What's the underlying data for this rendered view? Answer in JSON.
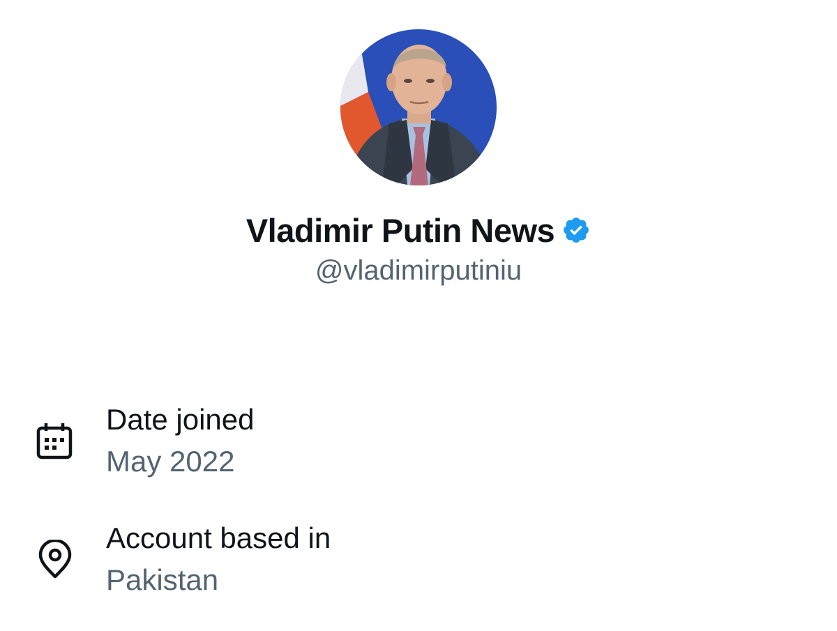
{
  "profile": {
    "display_name": "Vladimir Putin News",
    "handle": "@vladimirputiniu",
    "verified": true,
    "avatar_icon": "avatar-photo",
    "verified_icon": "verified-badge-icon",
    "verified_color": "#1d9bf0"
  },
  "about": {
    "date_joined": {
      "icon": "calendar-icon",
      "label": "Date joined",
      "value": "May 2022"
    },
    "account_based_in": {
      "icon": "location-pin-icon",
      "label": "Account based in",
      "value": "Pakistan"
    }
  },
  "colors": {
    "primary_text": "#0f1419",
    "secondary_text": "#536471",
    "background": "#ffffff"
  }
}
